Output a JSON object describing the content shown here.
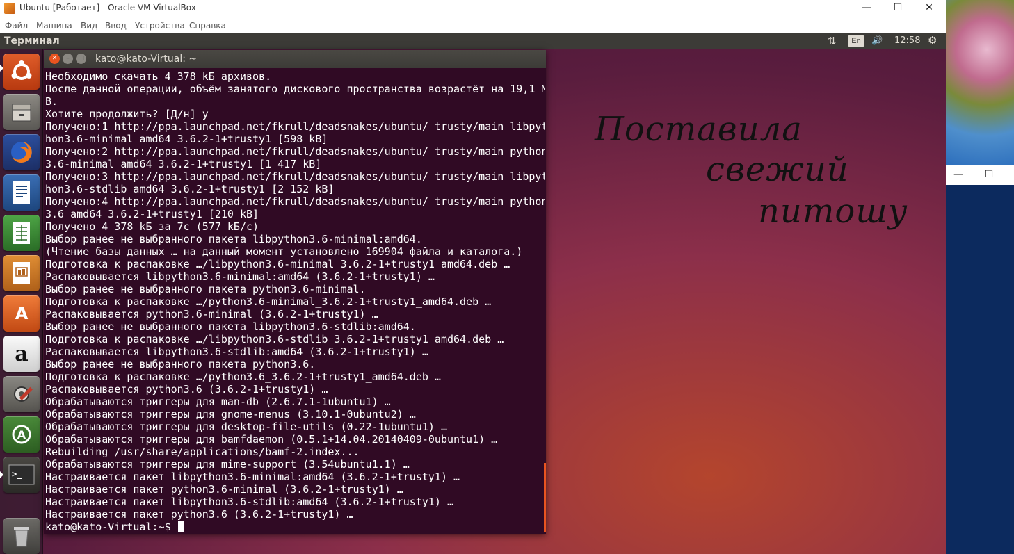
{
  "host_window": {
    "title": "Ubuntu [Работает] - Oracle VM VirtualBox",
    "buttons": [
      "—",
      "☐",
      "✕"
    ],
    "menu": [
      "Файл",
      "Машина",
      "Вид",
      "Ввод",
      "Устройства",
      "Справка"
    ]
  },
  "top_panel": {
    "app_title": "Терминал",
    "network": "⇅",
    "keyboard": "En",
    "volume": "🔊",
    "clock": "12:58",
    "settings": "⚙"
  },
  "launcher": {
    "icons": [
      "ubuntu-dash-icon",
      "files-icon",
      "firefox-icon",
      "writer-icon",
      "calc-icon",
      "impress-icon",
      "software-center-icon",
      "amazon-icon",
      "system-settings-icon",
      "software-updater-icon",
      "terminal-icon",
      "trash-icon"
    ]
  },
  "desktop_note": {
    "line1": "Поставила",
    "line2": "свежий",
    "line3": "питошу"
  },
  "terminal": {
    "title": "kato@kato-Virtual: ~",
    "lines": [
      "Необходимо скачать 4 378 kБ архивов.",
      "После данной операции, объём занятого дискового пространства возрастёт на 19,1 М",
      "B.",
      "Хотите продолжить? [Д/н] y",
      "Получено:1 http://ppa.launchpad.net/fkrull/deadsnakes/ubuntu/ trusty/main libpyt",
      "hon3.6-minimal amd64 3.6.2-1+trusty1 [598 kB]",
      "Получено:2 http://ppa.launchpad.net/fkrull/deadsnakes/ubuntu/ trusty/main python",
      "3.6-minimal amd64 3.6.2-1+trusty1 [1 417 kB]",
      "Получено:3 http://ppa.launchpad.net/fkrull/deadsnakes/ubuntu/ trusty/main libpyt",
      "hon3.6-stdlib amd64 3.6.2-1+trusty1 [2 152 kB]",
      "Получено:4 http://ppa.launchpad.net/fkrull/deadsnakes/ubuntu/ trusty/main python",
      "3.6 amd64 3.6.2-1+trusty1 [210 kB]",
      "Получено 4 378 kБ за 7c (577 kБ/c)",
      "Выбор ранее не выбранного пакета libpython3.6-minimal:amd64.",
      "(Чтение базы данных … на данный момент установлено 169904 файла и каталога.)",
      "Подготовка к распаковке …/libpython3.6-minimal_3.6.2-1+trusty1_amd64.deb …",
      "Распаковывается libpython3.6-minimal:amd64 (3.6.2-1+trusty1) …",
      "Выбор ранее не выбранного пакета python3.6-minimal.",
      "Подготовка к распаковке …/python3.6-minimal_3.6.2-1+trusty1_amd64.deb …",
      "Распаковывается python3.6-minimal (3.6.2-1+trusty1) …",
      "Выбор ранее не выбранного пакета libpython3.6-stdlib:amd64.",
      "Подготовка к распаковке …/libpython3.6-stdlib_3.6.2-1+trusty1_amd64.deb …",
      "Распаковывается libpython3.6-stdlib:amd64 (3.6.2-1+trusty1) …",
      "Выбор ранее не выбранного пакета python3.6.",
      "Подготовка к распаковке …/python3.6_3.6.2-1+trusty1_amd64.deb …",
      "Распаковывается python3.6 (3.6.2-1+trusty1) …",
      "Обрабатываются триггеры для man-db (2.6.7.1-1ubuntu1) …",
      "Обрабатываются триггеры для gnome-menus (3.10.1-0ubuntu2) …",
      "Обрабатываются триггеры для desktop-file-utils (0.22-1ubuntu1) …",
      "Обрабатываются триггеры для bamfdaemon (0.5.1+14.04.20140409-0ubuntu1) …",
      "Rebuilding /usr/share/applications/bamf-2.index...",
      "Обрабатываются триггеры для mime-support (3.54ubuntu1.1) …",
      "Настраивается пакет libpython3.6-minimal:amd64 (3.6.2-1+trusty1) …",
      "Настраивается пакет python3.6-minimal (3.6.2-1+trusty1) …",
      "Настраивается пакет libpython3.6-stdlib:amd64 (3.6.2-1+trusty1) …",
      "Настраивается пакет python3.6 (3.6.2-1+trusty1) …"
    ],
    "prompt": "kato@kato-Virtual:~$ "
  },
  "host_side_window": {
    "buttons": [
      "—",
      "☐"
    ]
  }
}
